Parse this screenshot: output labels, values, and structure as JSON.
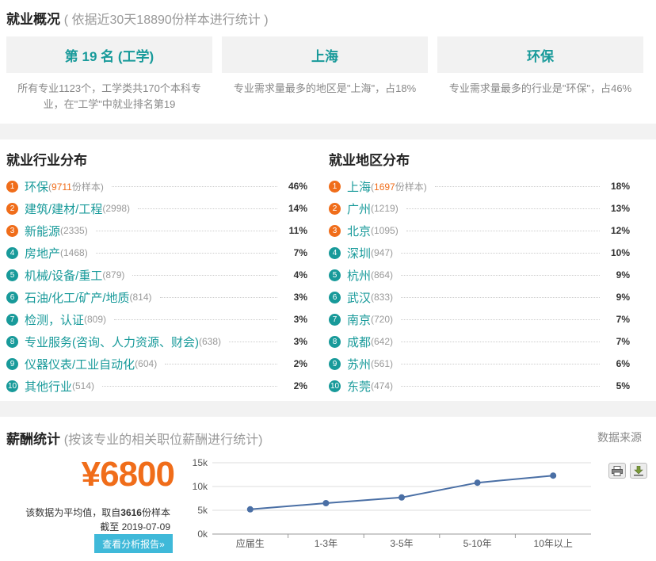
{
  "overview": {
    "title": "就业概况",
    "subtitle": "( 依据近30天18890份样本进行统计 )",
    "cards": [
      {
        "value": "第 19 名 (工学)",
        "desc": "所有专业1123个，工学类共170个本科专业，在\"工学\"中就业排名第19"
      },
      {
        "value": "上海",
        "desc": "专业需求量最多的地区是\"上海\"，占18%"
      },
      {
        "value": "环保",
        "desc": "专业需求量最多的行业是\"环保\"，占46%"
      }
    ]
  },
  "industry": {
    "title": "就业行业分布",
    "top_sample_suffix": "份样本",
    "items": [
      {
        "rank": "1",
        "name": "环保",
        "count": "9711",
        "pct": "46%"
      },
      {
        "rank": "2",
        "name": "建筑/建材/工程",
        "count": "(2998)",
        "pct": "14%"
      },
      {
        "rank": "3",
        "name": "新能源",
        "count": "(2335)",
        "pct": "11%"
      },
      {
        "rank": "4",
        "name": "房地产",
        "count": "(1468)",
        "pct": "7%"
      },
      {
        "rank": "5",
        "name": "机械/设备/重工",
        "count": "(879)",
        "pct": "4%"
      },
      {
        "rank": "6",
        "name": "石油/化工/矿产/地质",
        "count": "(814)",
        "pct": "3%"
      },
      {
        "rank": "7",
        "name": "检测，认证",
        "count": "(809)",
        "pct": "3%"
      },
      {
        "rank": "8",
        "name": "专业服务(咨询、人力资源、财会)",
        "count": "(638)",
        "pct": "3%"
      },
      {
        "rank": "9",
        "name": "仪器仪表/工业自动化",
        "count": "(604)",
        "pct": "2%"
      },
      {
        "rank": "10",
        "name": "其他行业",
        "count": "(514)",
        "pct": "2%"
      }
    ]
  },
  "region": {
    "title": "就业地区分布",
    "top_sample_suffix": "份样本",
    "items": [
      {
        "rank": "1",
        "name": "上海",
        "count": "1697",
        "pct": "18%"
      },
      {
        "rank": "2",
        "name": "广州",
        "count": "(1219)",
        "pct": "13%"
      },
      {
        "rank": "3",
        "name": "北京",
        "count": "(1095)",
        "pct": "12%"
      },
      {
        "rank": "4",
        "name": "深圳",
        "count": "(947)",
        "pct": "10%"
      },
      {
        "rank": "5",
        "name": "杭州",
        "count": "(864)",
        "pct": "9%"
      },
      {
        "rank": "6",
        "name": "武汉",
        "count": "(833)",
        "pct": "9%"
      },
      {
        "rank": "7",
        "name": "南京",
        "count": "(720)",
        "pct": "7%"
      },
      {
        "rank": "8",
        "name": "成都",
        "count": "(642)",
        "pct": "7%"
      },
      {
        "rank": "9",
        "name": "苏州",
        "count": "(561)",
        "pct": "6%"
      },
      {
        "rank": "10",
        "name": "东莞",
        "count": "(474)",
        "pct": "5%"
      }
    ]
  },
  "salary": {
    "title": "薪酬统计",
    "subtitle": "(按该专业的相关职位薪酬进行统计)",
    "source_label": "数据来源",
    "amount": "¥6800",
    "note_prefix": "该数据为平均值，取自",
    "note_count": "3616",
    "note_suffix": "份样本",
    "date_line": "截至 2019-07-09",
    "report_button": "查看分析报告»"
  },
  "colors": {
    "teal": "#189a9a",
    "orange": "#f06d1a",
    "line": "#4a6fa5",
    "button": "#3fb9d9"
  },
  "icons": {
    "print": "print-icon",
    "download": "download-icon"
  },
  "chart_data": {
    "type": "line",
    "categories": [
      "应届生",
      "1-3年",
      "3-5年",
      "5-10年",
      "10年以上"
    ],
    "series": [
      {
        "values": [
          5200,
          6500,
          7700,
          10800,
          12300
        ]
      }
    ],
    "yticks": [
      "0k",
      "5k",
      "10k",
      "15k"
    ],
    "ylim": [
      0,
      15000
    ],
    "grid": true
  }
}
